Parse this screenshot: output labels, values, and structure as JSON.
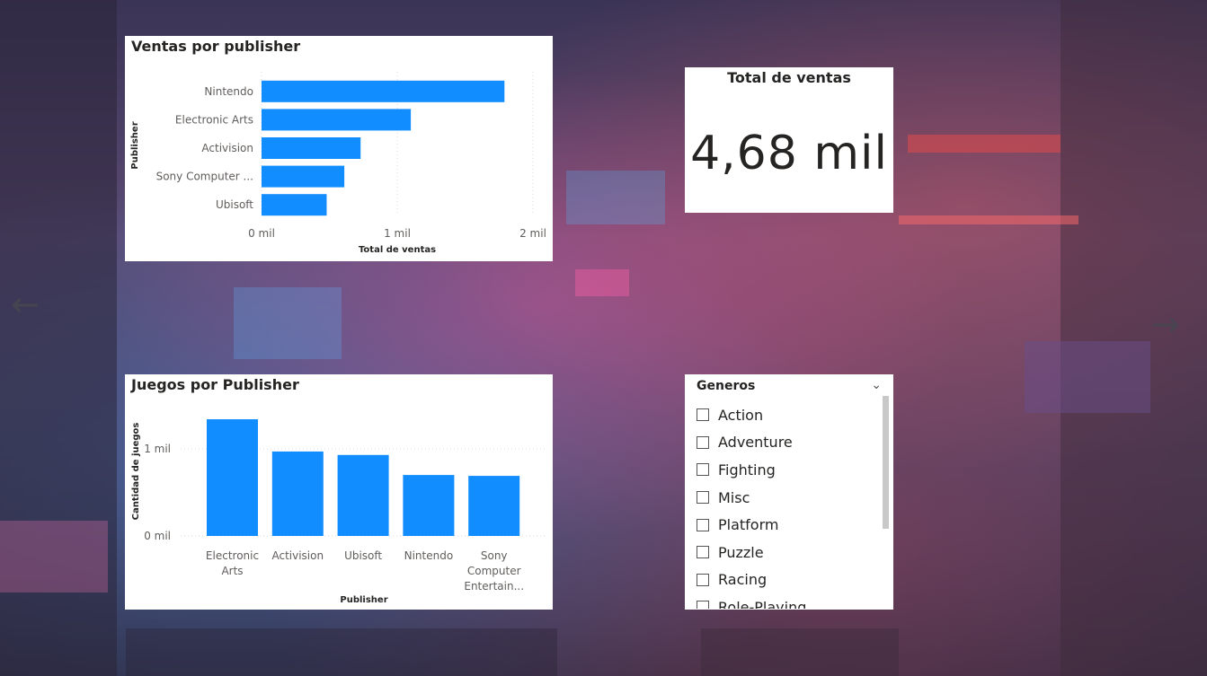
{
  "nav": {
    "prev_icon": "←",
    "next_icon": "→"
  },
  "chart1": {
    "title": "Ventas por publisher",
    "ylabel": "Publisher",
    "xlabel": "Total de ventas",
    "ticks": [
      "0 mil",
      "1 mil",
      "2 mil"
    ],
    "color": "#118DFF"
  },
  "chart2": {
    "title": "Juegos por Publisher",
    "ylabel": "Cantidad de juegos",
    "xlabel": "Publisher",
    "ticks": [
      "0 mil",
      "1 mil"
    ],
    "color": "#118DFF"
  },
  "kpi": {
    "title": "Total de ventas",
    "value": "4,68 mil"
  },
  "slicer": {
    "title": "Generos",
    "items": [
      "Action",
      "Adventure",
      "Fighting",
      "Misc",
      "Platform",
      "Puzzle",
      "Racing",
      "Role-Playing"
    ]
  },
  "chart_data": [
    {
      "type": "bar",
      "orientation": "horizontal",
      "title": "Ventas por publisher",
      "xlabel": "Total de ventas",
      "ylabel": "Publisher",
      "categories": [
        "Nintendo",
        "Electronic Arts",
        "Activision",
        "Sony Computer ...",
        "Ubisoft"
      ],
      "values": [
        1.79,
        1.1,
        0.73,
        0.61,
        0.48
      ],
      "unit": "mil",
      "xlim": [
        0,
        2
      ],
      "grid": true
    },
    {
      "type": "bar",
      "orientation": "vertical",
      "title": "Juegos por Publisher",
      "xlabel": "Publisher",
      "ylabel": "Cantidad de juegos",
      "categories": [
        [
          "Electronic",
          "Arts"
        ],
        [
          "Activision"
        ],
        [
          "Ubisoft"
        ],
        [
          "Nintendo"
        ],
        [
          "Sony",
          "Computer",
          "Entertain..."
        ]
      ],
      "values": [
        1.34,
        0.97,
        0.93,
        0.7,
        0.69
      ],
      "unit": "mil",
      "ylim": [
        0,
        1.4
      ],
      "grid": true
    }
  ]
}
